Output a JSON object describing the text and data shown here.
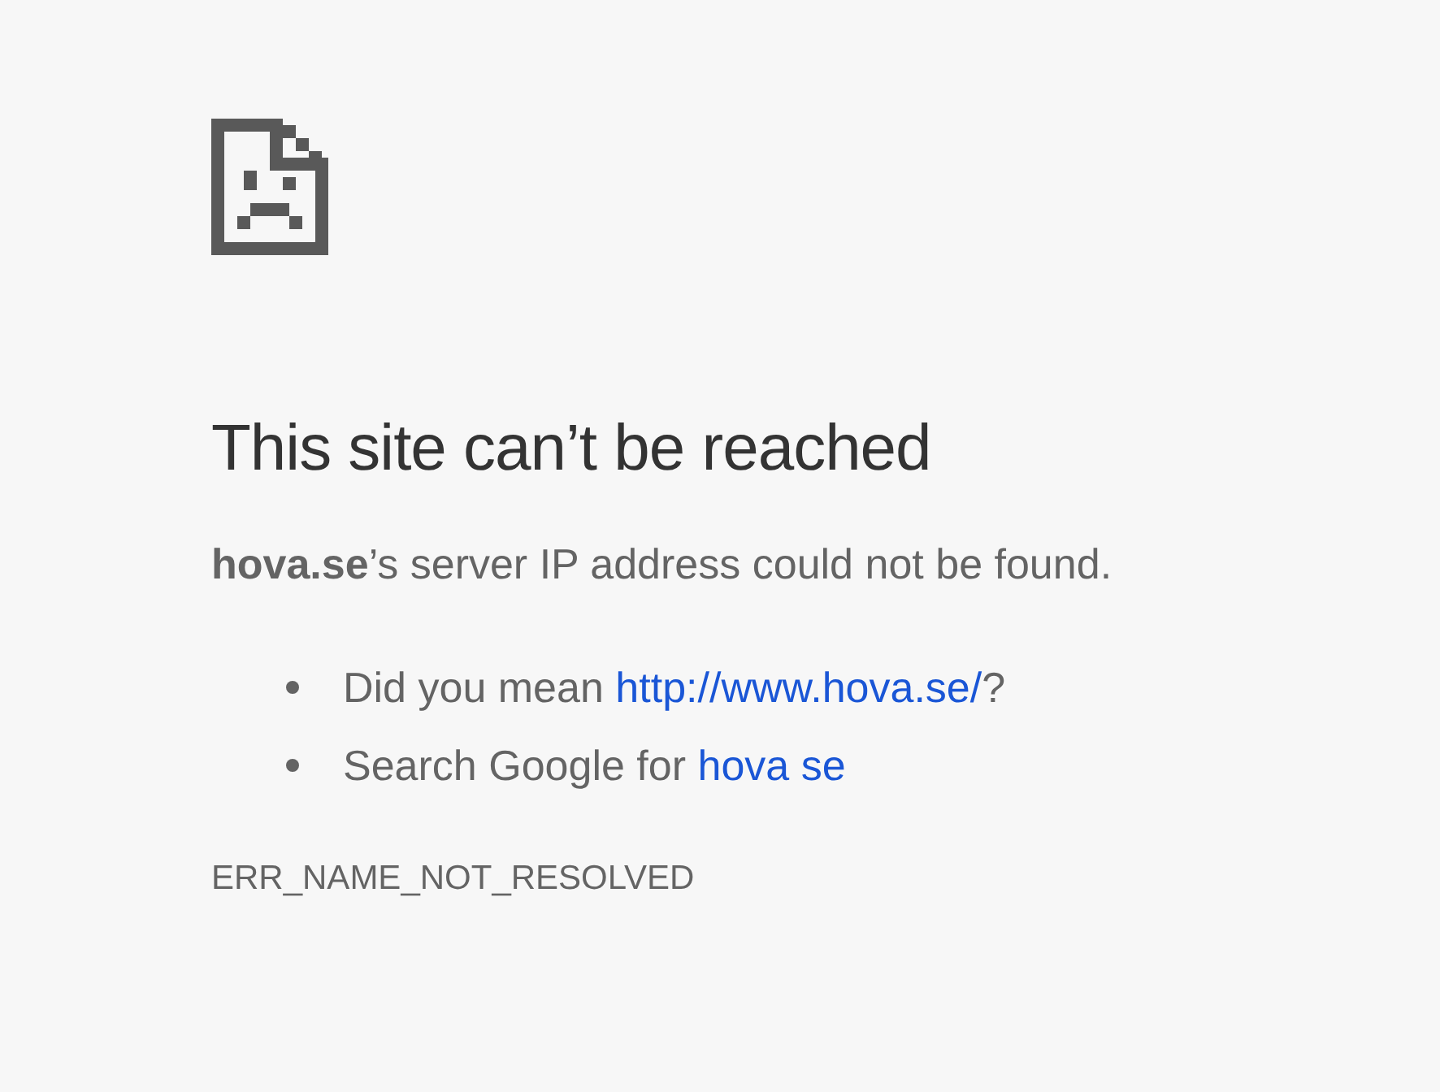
{
  "heading": "This site can’t be reached",
  "message": "**hova.se**’s server IP address could not be found.",
  "suggestions": [
    {
      "text_before": "Did you mean ",
      "link": "http://www.hova.se/",
      "text_after": "?"
    },
    {
      "text_before": "Search Google for ",
      "link": "hova se"
    }
  ],
  "error_code": "ERR_NAME_NOT_RESOLVED"
}
